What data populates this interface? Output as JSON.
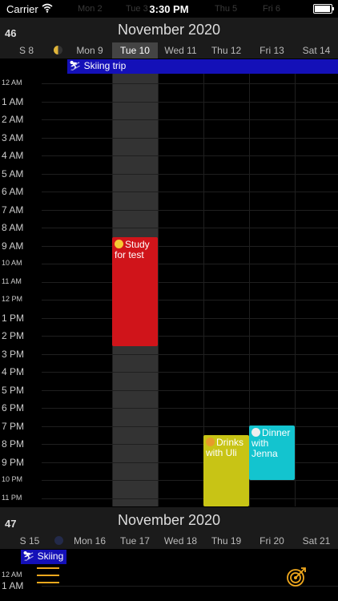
{
  "status_bar": {
    "carrier": "Carrier",
    "time": "3:30 PM",
    "ghost_days": [
      "Mon 2",
      "Tue 3",
      "Thu 5",
      "Fri 6"
    ]
  },
  "week1": {
    "week_number": "46",
    "month_title": "November 2020",
    "days": [
      {
        "label": "S 8",
        "today": false
      },
      {
        "label": "Mon 9",
        "today": false
      },
      {
        "label": "Tue 10",
        "today": true
      },
      {
        "label": "Wed 11",
        "today": false
      },
      {
        "label": "Thu 12",
        "today": false
      },
      {
        "label": "Fri 13",
        "today": false
      },
      {
        "label": "Sat 14",
        "today": false
      }
    ],
    "allday_event": {
      "title": "Skiing trip",
      "icon": "skier-icon"
    },
    "hours": [
      "12 AM",
      "1 AM",
      "2 AM",
      "3 AM",
      "4 AM",
      "5 AM",
      "6 AM",
      "7 AM",
      "8 AM",
      "9 AM",
      "10 AM",
      "11 AM",
      "12 PM",
      "1 PM",
      "2 PM",
      "3 PM",
      "4 PM",
      "5 PM",
      "6 PM",
      "7 PM",
      "8 PM",
      "9 PM",
      "10 PM",
      "11 PM"
    ],
    "events": [
      {
        "title": "Study for test",
        "icon": "nerd-face-icon",
        "color": "#d0141a"
      },
      {
        "title": "Drinks with Uli",
        "icon": "beer-icon",
        "color": "#c8c415"
      },
      {
        "title": "Dinner with Jenna",
        "icon": "plate-icon",
        "color": "#13c4cf"
      }
    ]
  },
  "week2": {
    "week_number": "47",
    "month_title": "November 2020",
    "days": [
      {
        "label": "S 15"
      },
      {
        "label": "Mon 16"
      },
      {
        "label": "Tue 17"
      },
      {
        "label": "Wed 18"
      },
      {
        "label": "Thu 19"
      },
      {
        "label": "Fri 20"
      },
      {
        "label": "Sat 21"
      }
    ],
    "allday_event": {
      "title": "Skiing",
      "icon": "skier-icon"
    },
    "hours": [
      "12 AM",
      "1 AM"
    ]
  },
  "colors": {
    "accent": "#f0a81d",
    "allday_bar": "#1410b8",
    "today_column": "#333333"
  },
  "toolbar": {
    "menu_icon": "hamburger-menu-icon",
    "target_icon": "target-icon"
  }
}
